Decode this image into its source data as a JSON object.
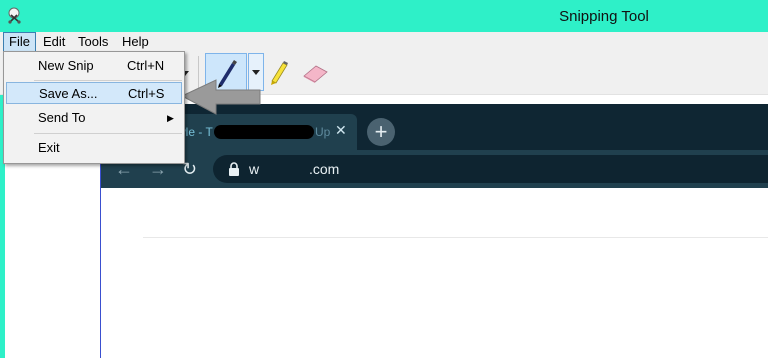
{
  "window": {
    "title": "Snipping Tool",
    "accent": "#2ef0c8"
  },
  "menubar": {
    "file": "File",
    "edit": "Edit",
    "tools": "Tools",
    "help": "Help"
  },
  "file_menu": {
    "new_snip": {
      "label": "New Snip",
      "shortcut": "Ctrl+N"
    },
    "save_as": {
      "label": "Save As...",
      "shortcut": "Ctrl+S"
    },
    "send_to": {
      "label": "Send To",
      "submenu_glyph": "▶"
    },
    "exit": {
      "label": "Exit"
    }
  },
  "toolbar": {
    "icons": [
      "chevron-down-icon",
      "pen-icon",
      "highlighter-icon",
      "eraser-icon"
    ]
  },
  "captured_browser": {
    "tab_title_start": "wle - T",
    "tab_title_end": "Up",
    "close_glyph": "✕",
    "new_tab_glyph": "+",
    "back_glyph": "←",
    "forward_glyph": "→",
    "reload_glyph": "↻",
    "url_start": "w",
    "url_end": ".com"
  }
}
